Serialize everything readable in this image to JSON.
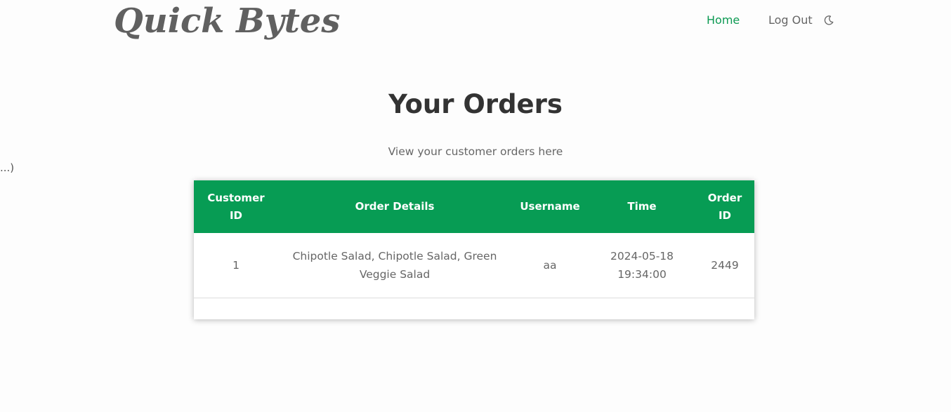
{
  "header": {
    "brand": "Quick Bytes",
    "nav": {
      "home": "Home",
      "logout": "Log Out",
      "theme_icon": "moon-icon"
    }
  },
  "stray_text": "...)",
  "main": {
    "title": "Your Orders",
    "subtitle": "View your customer orders here"
  },
  "orders_table": {
    "columns": [
      "Customer ID",
      "Order Details",
      "Username",
      "Time",
      "Order ID"
    ],
    "rows": [
      {
        "customer_id": "1",
        "order_details": "Chipotle Salad, Chipotle Salad, Green Veggie Salad",
        "username": "aa",
        "time": "2024-05-18 19:34:00",
        "order_id": "2449"
      }
    ]
  },
  "colors": {
    "accent": "#079c54",
    "text": "#666666",
    "heading": "#333333"
  }
}
